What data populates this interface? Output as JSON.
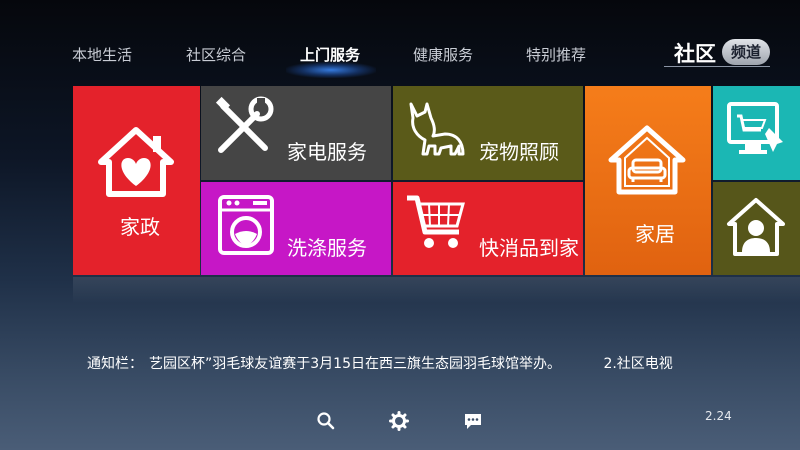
{
  "nav": {
    "items": [
      {
        "label": "本地生活",
        "active": false
      },
      {
        "label": "社区综合",
        "active": false
      },
      {
        "label": "上门服务",
        "active": true
      },
      {
        "label": "健康服务",
        "active": false
      },
      {
        "label": "特别推荐",
        "active": false
      }
    ],
    "channel": {
      "main": "社区",
      "pill": "频道"
    }
  },
  "tiles": {
    "jiazheng": {
      "label": "家政",
      "color": "#e4222b",
      "icon": "house-heart-icon"
    },
    "jiadian": {
      "label": "家电服务",
      "color": "#454545",
      "icon": "tools-icon"
    },
    "chongwu": {
      "label": "宠物照顾",
      "color": "#5a5a19",
      "icon": "cat-icon"
    },
    "xidi": {
      "label": "洗涤服务",
      "color": "#c617c6",
      "icon": "washing-machine-icon"
    },
    "kuaixiao": {
      "label": "快消品到家",
      "color": "#e4222b",
      "icon": "shopping-cart-icon"
    },
    "jiaju": {
      "label": "家居",
      "color": "#f57d1a",
      "icon": "house-sofa-icon"
    },
    "gouwu": {
      "color": "#1bb7b4",
      "icon": "online-shopping-icon"
    },
    "fuwu": {
      "color": "#56561a",
      "icon": "house-person-icon"
    }
  },
  "ticker": {
    "prefix": "通知栏：",
    "text": "艺园区杯”羽毛球友谊赛于3月15日在西三旗生态园羽毛球馆举办。",
    "next": "2.社区电视"
  },
  "bottom": {
    "icons": [
      "search-icon",
      "gear-icon",
      "chat-icon"
    ],
    "version": "2.24"
  }
}
